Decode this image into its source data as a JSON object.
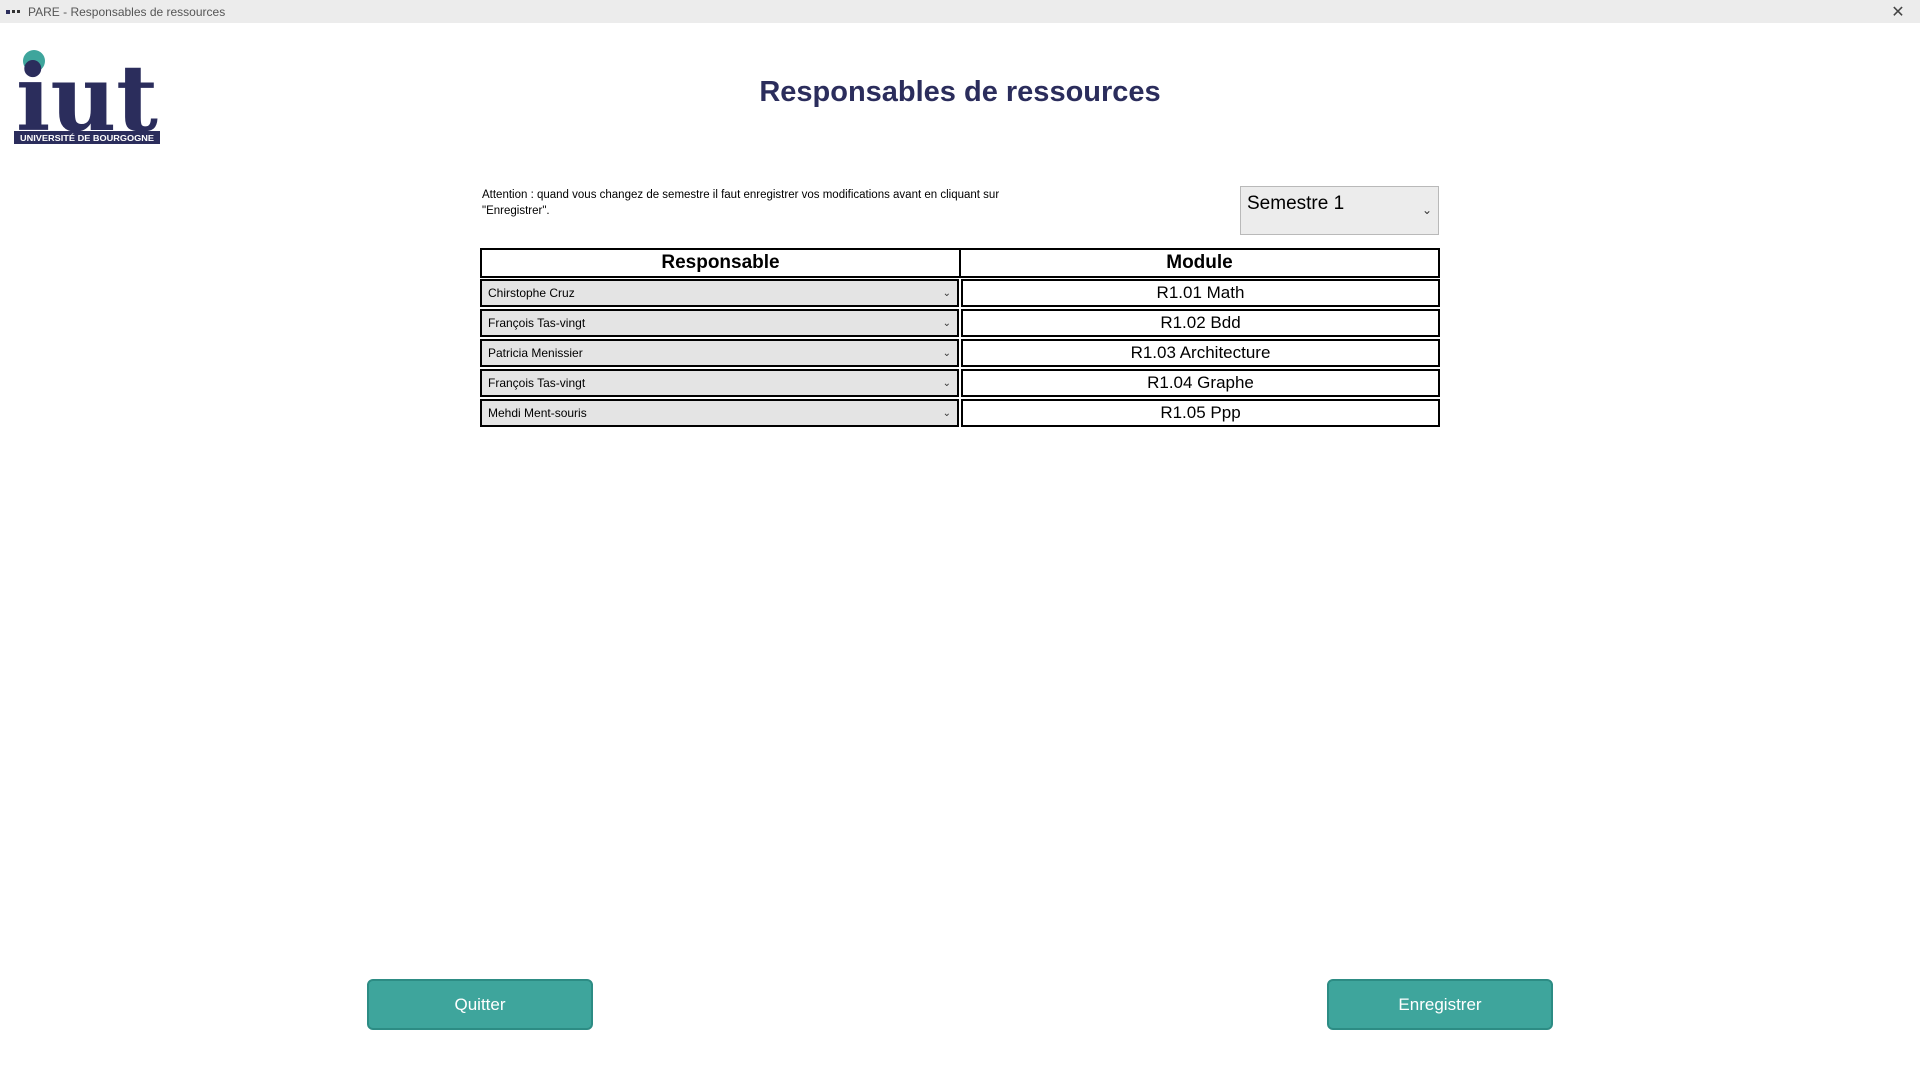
{
  "window": {
    "title": "PARE - Responsables de ressources",
    "close_glyph": "✕"
  },
  "logo": {
    "word": "iut",
    "subtitle": "UNIVERSITÉ DE BOURGOGNE",
    "brand_color": "#2b2d5c",
    "dot_color": "#3ea59c"
  },
  "page": {
    "title": "Responsables de ressources",
    "warning": "Attention : quand vous changez de semestre il faut enregistrer vos modifications avant en cliquant sur \"Enregistrer\"."
  },
  "semester_select": {
    "value": "Semestre 1",
    "chevron": "⌄"
  },
  "grid": {
    "headers": {
      "responsable": "Responsable",
      "module": "Module"
    },
    "chevron": "⌄",
    "rows": [
      {
        "responsable": "Chirstophe Cruz",
        "module": "R1.01 Math"
      },
      {
        "responsable": "François Tas-vingt",
        "module": "R1.02 Bdd"
      },
      {
        "responsable": "Patricia Menissier",
        "module": "R1.03 Architecture"
      },
      {
        "responsable": "François Tas-vingt",
        "module": "R1.04 Graphe"
      },
      {
        "responsable": "Mehdi Ment-souris",
        "module": "R1.05 Ppp"
      }
    ]
  },
  "buttons": {
    "quit": "Quitter",
    "save": "Enregistrer",
    "color": "#3ea59c"
  }
}
